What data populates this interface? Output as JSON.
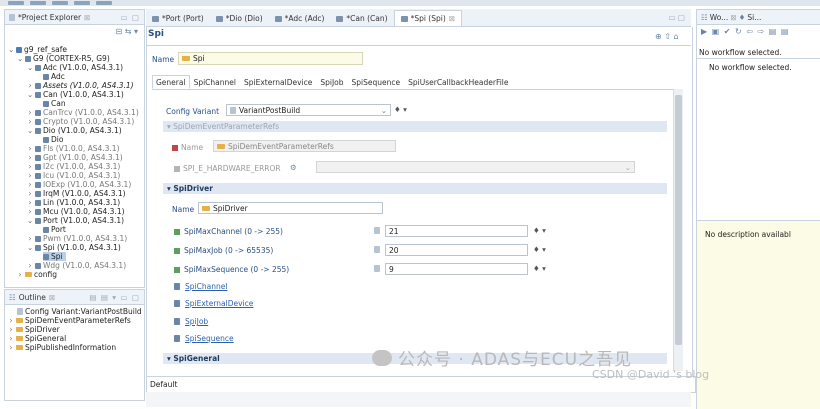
{
  "project_explorer": {
    "title": "*Project Explorer",
    "nodes": [
      {
        "label": "g9_ref_safe"
      },
      {
        "label": "G9 (CORTEX-R5, G9)"
      },
      {
        "label": "Adc (V1.0.0, AS4.3.1)"
      },
      {
        "label": "Adc"
      },
      {
        "label": "Assets (V1.0.0, AS4.3.1)"
      },
      {
        "label": "Can (V1.0.0, AS4.3.1)"
      },
      {
        "label": "Can"
      },
      {
        "label": "CanTrcv (V1.0.0, AS4.3.1)"
      },
      {
        "label": "Crypto (V1.0.0, AS4.3.1)"
      },
      {
        "label": "Dio (V1.0.0, AS4.3.1)"
      },
      {
        "label": "Dio"
      },
      {
        "label": "Fls (V1.0.0, AS4.3.1)"
      },
      {
        "label": "Gpt (V1.0.0, AS4.3.1)"
      },
      {
        "label": "I2c (V1.0.0, AS4.3.1)"
      },
      {
        "label": "Icu (V1.0.0, AS4.3.1)"
      },
      {
        "label": "IOExp (V1.0.0, AS4.3.1)"
      },
      {
        "label": "IrqM (V1.0.0, AS4.3.1)"
      },
      {
        "label": "Lin (V1.0.0, AS4.3.1)"
      },
      {
        "label": "Mcu (V1.0.0, AS4.3.1)"
      },
      {
        "label": "Port (V1.0.0, AS4.3.1)"
      },
      {
        "label": "Port"
      },
      {
        "label": "Pwm (V1.0.0, AS4.3.1)"
      },
      {
        "label": "Spi (V1.0.0, AS4.3.1)"
      },
      {
        "label": "Spi"
      },
      {
        "label": "Wdg (V1.0.0, AS4.3.1)"
      },
      {
        "label": "config"
      }
    ]
  },
  "outline": {
    "title": "Outline",
    "items": [
      {
        "label": "Config Variant:VariantPostBuild"
      },
      {
        "label": "SpiDemEventParameterRefs"
      },
      {
        "label": "SpiDriver"
      },
      {
        "label": "SpiGeneral"
      },
      {
        "label": "SpiPublishedInformation"
      }
    ]
  },
  "editor_tabs": [
    {
      "label": "*Port (Port)"
    },
    {
      "label": "*Dio (Dio)"
    },
    {
      "label": "*Adc (Adc)"
    },
    {
      "label": "*Can (Can)"
    },
    {
      "label": "*Spi (Spi)"
    }
  ],
  "editor": {
    "title": "Spi",
    "name_label": "Name",
    "name_value": "Spi",
    "sub_tabs": [
      "General",
      "SpiChannel",
      "SpiExternalDevice",
      "SpiJob",
      "SpiSequence",
      "SpiUserCallbackHeaderFile"
    ],
    "config_variant_label": "Config Variant",
    "config_variant_value": "VariantPostBuild",
    "dem_section": "SpiDemEventParameterRefs",
    "dem_name_label": "Name",
    "dem_name_value": "SpiDemEventParameterRefs",
    "hw_error_label": "SPI_E_HARDWARE_ERROR",
    "driver_section": "SpiDriver",
    "driver_name_label": "Name",
    "driver_name_value": "SpiDriver",
    "params": [
      {
        "label": "SpiMaxChannel (0 -> 255)",
        "value": "21"
      },
      {
        "label": "SpiMaxJob (0 -> 65535)",
        "value": "20"
      },
      {
        "label": "SpiMaxSequence (0 -> 255)",
        "value": "9"
      }
    ],
    "links": [
      "SpiChannel",
      "SpiExternalDevice",
      "SpiJob",
      "SpiSequence"
    ],
    "general_section": "SpiGeneral",
    "bottom_tab": "Default"
  },
  "workflow": {
    "tab_title": "Wo...",
    "tab_title2": "Si...",
    "header_text": "No workflow selected.",
    "body_text": "No workflow selected.",
    "description_text": "No description availabl"
  },
  "watermark": {
    "text": "公众号 · ADAS与ECU之吾见",
    "csdn": "CSDN @David 's blog"
  },
  "colors": {
    "accent": "#2a4f84",
    "link": "#2d62b0",
    "selection": "#b9cfe8",
    "section_bg": "#dfe8f2"
  }
}
